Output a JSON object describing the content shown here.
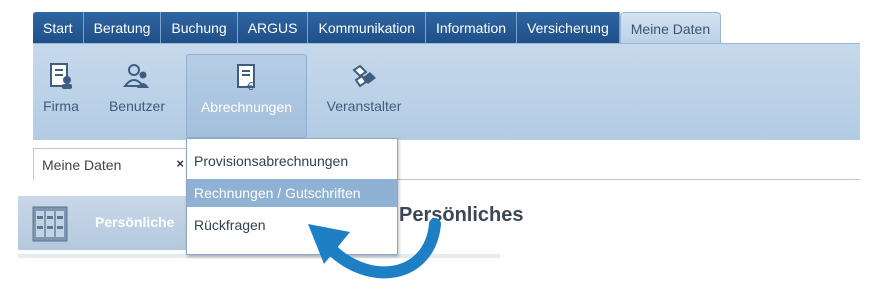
{
  "tabs": [
    {
      "label": "Start"
    },
    {
      "label": "Beratung"
    },
    {
      "label": "Buchung"
    },
    {
      "label": "ARGUS"
    },
    {
      "label": "Kommunikation"
    },
    {
      "label": "Information"
    },
    {
      "label": "Versicherung"
    },
    {
      "label": "Meine Daten",
      "active": true
    }
  ],
  "toolbar": {
    "items": [
      {
        "label": "Firma",
        "icon": "company-icon"
      },
      {
        "label": "Benutzer",
        "icon": "users-icon"
      },
      {
        "label": "Abrechnungen",
        "icon": "invoice-icon",
        "selected": true
      },
      {
        "label": "Veranstalter",
        "icon": "organizer-icon"
      }
    ]
  },
  "dropdown": {
    "items": [
      {
        "label": "Provisionsabrechnungen"
      },
      {
        "label": "Rechnungen / Gutschriften",
        "hover": true
      },
      {
        "label": "Rückfragen"
      }
    ]
  },
  "doc_tab": {
    "label": "Meine Daten",
    "close": "×"
  },
  "panel": {
    "label": "Persönliche"
  },
  "heading": "Persönliches",
  "colors": {
    "tab_blue": "#2a5c97",
    "toolbar_bg": "#bfd4ea",
    "hover_blue": "#8fb2d4",
    "arrow_blue": "#1e7fc4"
  }
}
